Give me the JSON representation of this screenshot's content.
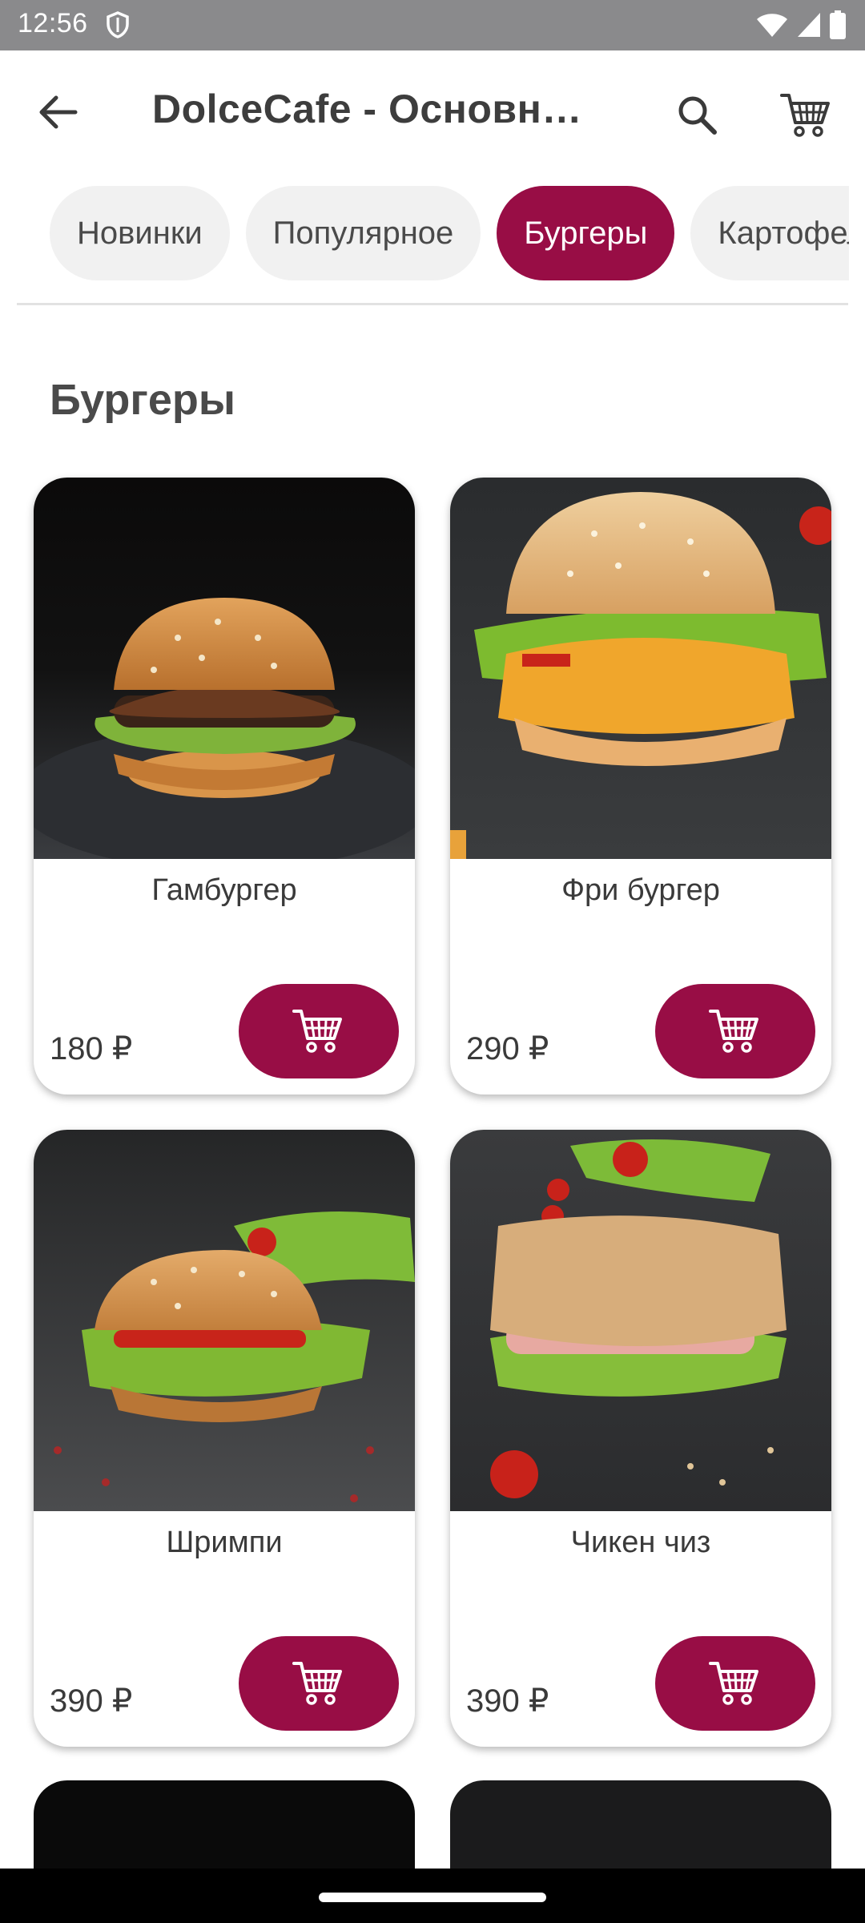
{
  "status": {
    "time": "12:56"
  },
  "app_bar": {
    "title": "DolceCafe - Основн…"
  },
  "categories": [
    {
      "label": "Новинки",
      "active": false
    },
    {
      "label": "Популярное",
      "active": false
    },
    {
      "label": "Бургеры",
      "active": true
    },
    {
      "label": "Картофель",
      "active": false
    }
  ],
  "section": {
    "title": "Бургеры"
  },
  "products": [
    {
      "name": "Гамбургер",
      "price": "180 ₽"
    },
    {
      "name": "Фри бургер",
      "price": "290 ₽"
    },
    {
      "name": "Шримпи",
      "price": "390 ₽"
    },
    {
      "name": "Чикен чиз",
      "price": "390 ₽"
    }
  ],
  "colors": {
    "accent": "#980d45",
    "status_bar": "#8a8a8c",
    "chip_bg": "#f1f1f1"
  },
  "icons": {
    "back": "arrow-left-icon",
    "search": "search-icon",
    "cart": "cart-icon"
  }
}
